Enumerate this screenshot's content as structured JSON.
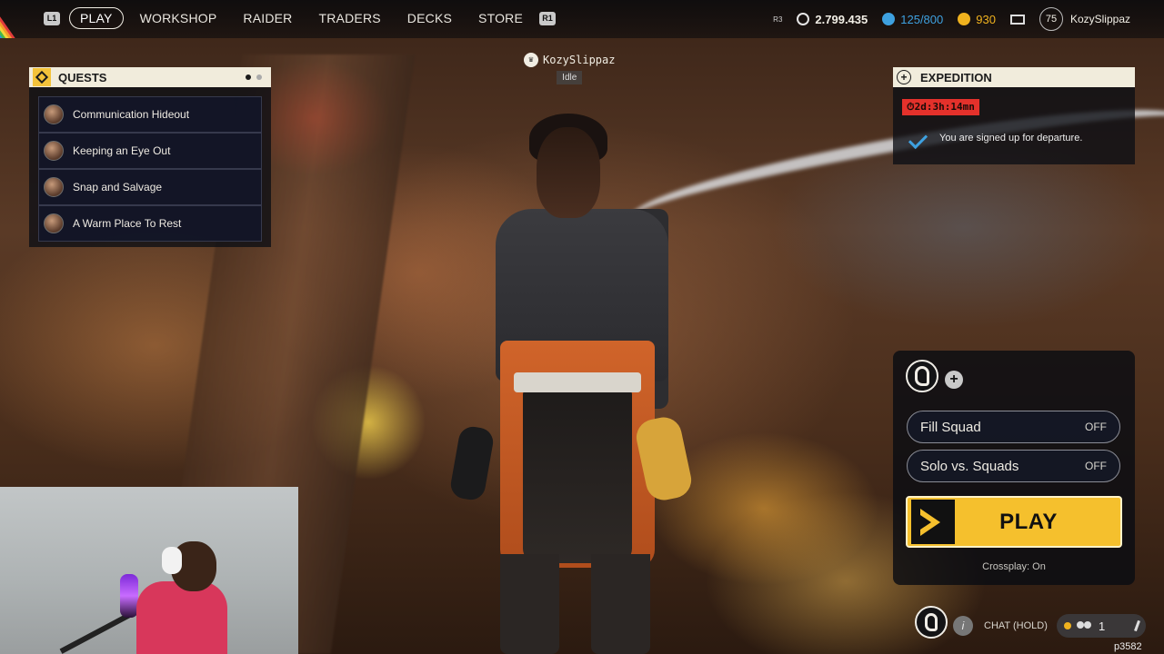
{
  "nav": {
    "left_hint": "L1",
    "right_hint": "R1",
    "tabs": [
      {
        "label": "PLAY",
        "active": true
      },
      {
        "label": "WORKSHOP",
        "active": false
      },
      {
        "label": "RAIDER",
        "active": false
      },
      {
        "label": "TRADERS",
        "active": false
      },
      {
        "label": "DECKS",
        "active": false
      },
      {
        "label": "STORE",
        "active": false
      }
    ]
  },
  "hud": {
    "r3_hint": "R3",
    "coins": "2.799.435",
    "tickets": "125/800",
    "tokens": "930",
    "level": "75",
    "username": "KozySlippaz",
    "icons": [
      "coin-icon",
      "ticket-icon",
      "token-icon",
      "mail-icon"
    ],
    "colors": {
      "coins": "#e6e6e6",
      "tickets": "#3ea1e0",
      "tokens": "#f0b21e"
    }
  },
  "quests": {
    "title": "QUESTS",
    "items": [
      {
        "label": "Communication Hideout"
      },
      {
        "label": "Keeping an Eye Out"
      },
      {
        "label": "Snap and Salvage"
      },
      {
        "label": "A Warm Place To Rest"
      }
    ]
  },
  "player": {
    "name": "KozySlippaz",
    "status": "Idle"
  },
  "expedition": {
    "title": "EXPEDITION",
    "timer": "2d:3h:14mn",
    "message": "You are signed up for departure."
  },
  "squad": {
    "options": [
      {
        "label": "Fill Squad",
        "state": "OFF"
      },
      {
        "label": "Solo vs. Squads",
        "state": "OFF"
      }
    ],
    "play_label": "PLAY",
    "crossplay": "Crossplay: On",
    "accent": "#f5c02d"
  },
  "bottom": {
    "chat_label": "CHAT (HOLD)",
    "party_count": "1",
    "watermark": "p3582"
  }
}
